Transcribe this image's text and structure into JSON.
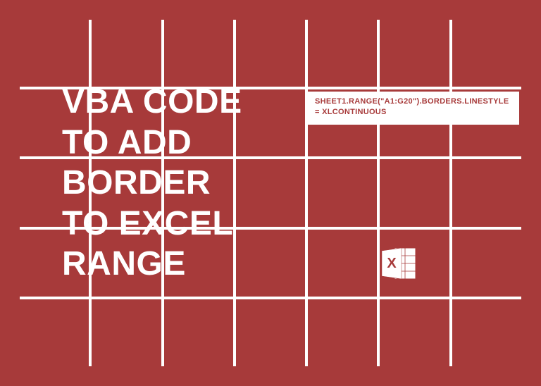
{
  "title": {
    "line1": "VBA CODE",
    "line2": "TO ADD",
    "line3": "BORDER",
    "line4": "TO EXCEL",
    "line5": "RANGE"
  },
  "codeSnippet": {
    "line1": "SHEET1.RANGE(\"A1:G20\").BORDERS.LINESTYLE",
    "line2": "= XLCONTINUOUS"
  },
  "icon": {
    "letter": "X"
  },
  "colors": {
    "background": "#a73a3a",
    "gridLine": "#ffffff",
    "text": "#ffffff",
    "codeText": "#a73a3a"
  }
}
